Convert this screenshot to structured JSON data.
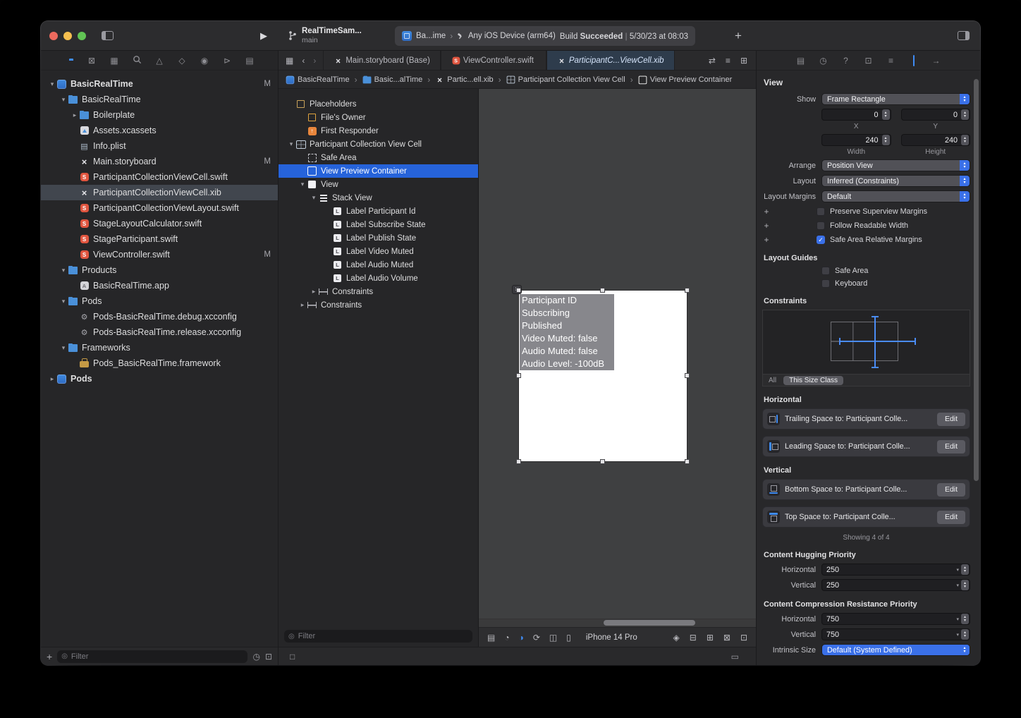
{
  "colors": {
    "accent": "#3f8cf4",
    "selection_blue": "#2663da",
    "swift_orange": "#e0553f",
    "folder_blue": "#4a90d9"
  },
  "toolbar": {
    "scheme_name": "RealTimeSam...",
    "scheme_subtitle": "main",
    "status": {
      "target": "Ba...ime",
      "destination": "Any iOS Device (arm64)",
      "build_label": "Build",
      "build_result": "Succeeded",
      "separator": "|",
      "build_time": "5/30/23 at 08:03"
    },
    "icons": {
      "play": "▶",
      "add_tab": "+"
    }
  },
  "tab_bar": {
    "back": "‹",
    "forward": "›",
    "tabs": [
      {
        "label": "Main.storyboard (Base)",
        "icon": "storyboard",
        "active": false
      },
      {
        "label": "ViewController.swift",
        "icon": "swift",
        "active": false
      },
      {
        "label": "ParticipantC...ViewCell.xib",
        "icon": "xib",
        "active": true
      }
    ]
  },
  "jump_bar": {
    "crumbs": [
      {
        "label": "BasicRealTime",
        "icon": "project"
      },
      {
        "label": "Basic...alTime",
        "icon": "folder"
      },
      {
        "label": "Partic...ell.xib",
        "icon": "xib"
      },
      {
        "label": "Participant Collection View Cell",
        "icon": "cell"
      },
      {
        "label": "View Preview Container",
        "icon": "view-outline"
      }
    ]
  },
  "navigator": {
    "files": [
      {
        "name": "BasicRealTime",
        "icon": "project",
        "depth": 0,
        "chevron": "down",
        "badge": "M",
        "bold": true
      },
      {
        "name": "BasicRealTime",
        "icon": "folder",
        "depth": 1,
        "chevron": "down"
      },
      {
        "name": "Boilerplate",
        "icon": "folder",
        "depth": 2,
        "chevron": "right"
      },
      {
        "name": "Assets.xcassets",
        "icon": "assets",
        "depth": 2
      },
      {
        "name": "Info.plist",
        "icon": "plist",
        "depth": 2
      },
      {
        "name": "Main.storyboard",
        "icon": "storyboard",
        "depth": 2,
        "badge": "M"
      },
      {
        "name": "ParticipantCollectionViewCell.swift",
        "icon": "swift",
        "depth": 2
      },
      {
        "name": "ParticipantCollectionViewCell.xib",
        "icon": "xib",
        "depth": 2,
        "selected": true
      },
      {
        "name": "ParticipantCollectionViewLayout.swift",
        "icon": "swift",
        "depth": 2
      },
      {
        "name": "StageLayoutCalculator.swift",
        "icon": "swift",
        "depth": 2
      },
      {
        "name": "StageParticipant.swift",
        "icon": "swift",
        "depth": 2
      },
      {
        "name": "ViewController.swift",
        "icon": "swift",
        "depth": 2,
        "badge": "M"
      },
      {
        "name": "Products",
        "icon": "folder",
        "depth": 1,
        "chevron": "down"
      },
      {
        "name": "BasicRealTime.app",
        "icon": "app",
        "depth": 2
      },
      {
        "name": "Pods",
        "icon": "folder",
        "depth": 1,
        "chevron": "down"
      },
      {
        "name": "Pods-BasicRealTime.debug.xcconfig",
        "icon": "xcconfig",
        "depth": 2
      },
      {
        "name": "Pods-BasicRealTime.release.xcconfig",
        "icon": "xcconfig",
        "depth": 2
      },
      {
        "name": "Frameworks",
        "icon": "folder",
        "depth": 1,
        "chevron": "down"
      },
      {
        "name": "Pods_BasicRealTime.framework",
        "icon": "framework",
        "depth": 2
      },
      {
        "name": "Pods",
        "icon": "project",
        "depth": 0,
        "chevron": "right",
        "bold": true
      }
    ],
    "filter_placeholder": "Filter"
  },
  "outline": {
    "items": [
      {
        "name": "Placeholders",
        "icon": "placeholders",
        "depth": 0
      },
      {
        "name": "File's Owner",
        "icon": "cube",
        "depth": 1
      },
      {
        "name": "First Responder",
        "icon": "responder",
        "depth": 1
      },
      {
        "name": "Participant Collection View Cell",
        "icon": "cell",
        "depth": 0,
        "chevron": "down"
      },
      {
        "name": "Safe Area",
        "icon": "safearea",
        "depth": 1
      },
      {
        "name": "View Preview Container",
        "icon": "view-outline",
        "depth": 1,
        "selected": true
      },
      {
        "name": "View",
        "icon": "view",
        "depth": 1,
        "chevron": "down"
      },
      {
        "name": "Stack View",
        "icon": "stack",
        "depth": 2,
        "chevron": "down"
      },
      {
        "name": "Label Participant Id",
        "icon": "label",
        "depth": 3
      },
      {
        "name": "Label Subscribe State",
        "icon": "label",
        "depth": 3
      },
      {
        "name": "Label Publish State",
        "icon": "label",
        "depth": 3
      },
      {
        "name": "Label Video Muted",
        "icon": "label",
        "depth": 3
      },
      {
        "name": "Label Audio Muted",
        "icon": "label",
        "depth": 3
      },
      {
        "name": "Label Audio Volume",
        "icon": "label",
        "depth": 3
      },
      {
        "name": "Constraints",
        "icon": "constraints",
        "depth": 2,
        "chevron": "right"
      },
      {
        "name": "Constraints",
        "icon": "constraints",
        "depth": 1,
        "chevron": "right"
      }
    ],
    "filter_placeholder": "Filter"
  },
  "canvas": {
    "preview_labels": [
      "Participant ID",
      "Subscribing",
      "Published",
      "Video Muted: false",
      "Audio Muted: false",
      "Audio Level: -100dB"
    ],
    "device_name": "iPhone 14 Pro"
  },
  "inspector": {
    "title": "View",
    "show": {
      "label": "Show",
      "value": "Frame Rectangle"
    },
    "position": {
      "x": "0",
      "y": "0",
      "x_label": "X",
      "y_label": "Y"
    },
    "size": {
      "width": "240",
      "height": "240",
      "width_label": "Width",
      "height_label": "Height"
    },
    "arrange": {
      "label": "Arrange",
      "value": "Position View"
    },
    "layout": {
      "label": "Layout",
      "value": "Inferred (Constraints)"
    },
    "layout_margins": {
      "label": "Layout Margins",
      "value": "Default"
    },
    "margin_options": [
      {
        "label": "Preserve Superview Margins",
        "checked": false
      },
      {
        "label": "Follow Readable Width",
        "checked": false
      },
      {
        "label": "Safe Area Relative Margins",
        "checked": true
      }
    ],
    "layout_guides": {
      "title": "Layout Guides",
      "options": [
        {
          "label": "Safe Area",
          "checked": false
        },
        {
          "label": "Keyboard",
          "checked": false
        }
      ]
    },
    "constraints": {
      "title": "Constraints",
      "filter_all": "All",
      "filter_size_class": "This Size Class",
      "horizontal_title": "Horizontal",
      "vertical_title": "Vertical",
      "horizontal": [
        {
          "label": "Trailing Space to:  Participant Colle...",
          "icon": "trailing",
          "edit": "Edit"
        },
        {
          "label": "Leading Space to:  Participant Colle...",
          "icon": "leading",
          "edit": "Edit"
        }
      ],
      "vertical": [
        {
          "label": "Bottom Space to:  Participant Colle...",
          "icon": "bottom",
          "edit": "Edit"
        },
        {
          "label": "Top Space to:  Participant Colle...",
          "icon": "top",
          "edit": "Edit"
        }
      ],
      "showing": "Showing 4 of 4"
    },
    "hugging": {
      "title": "Content Hugging Priority",
      "horizontal_label": "Horizontal",
      "horizontal": "250",
      "vertical_label": "Vertical",
      "vertical": "250"
    },
    "compression": {
      "title": "Content Compression Resistance Priority",
      "horizontal_label": "Horizontal",
      "horizontal": "750",
      "vertical_label": "Vertical",
      "vertical": "750"
    },
    "intrinsic": {
      "label": "Intrinsic Size",
      "value": "Default (System Defined)"
    }
  }
}
